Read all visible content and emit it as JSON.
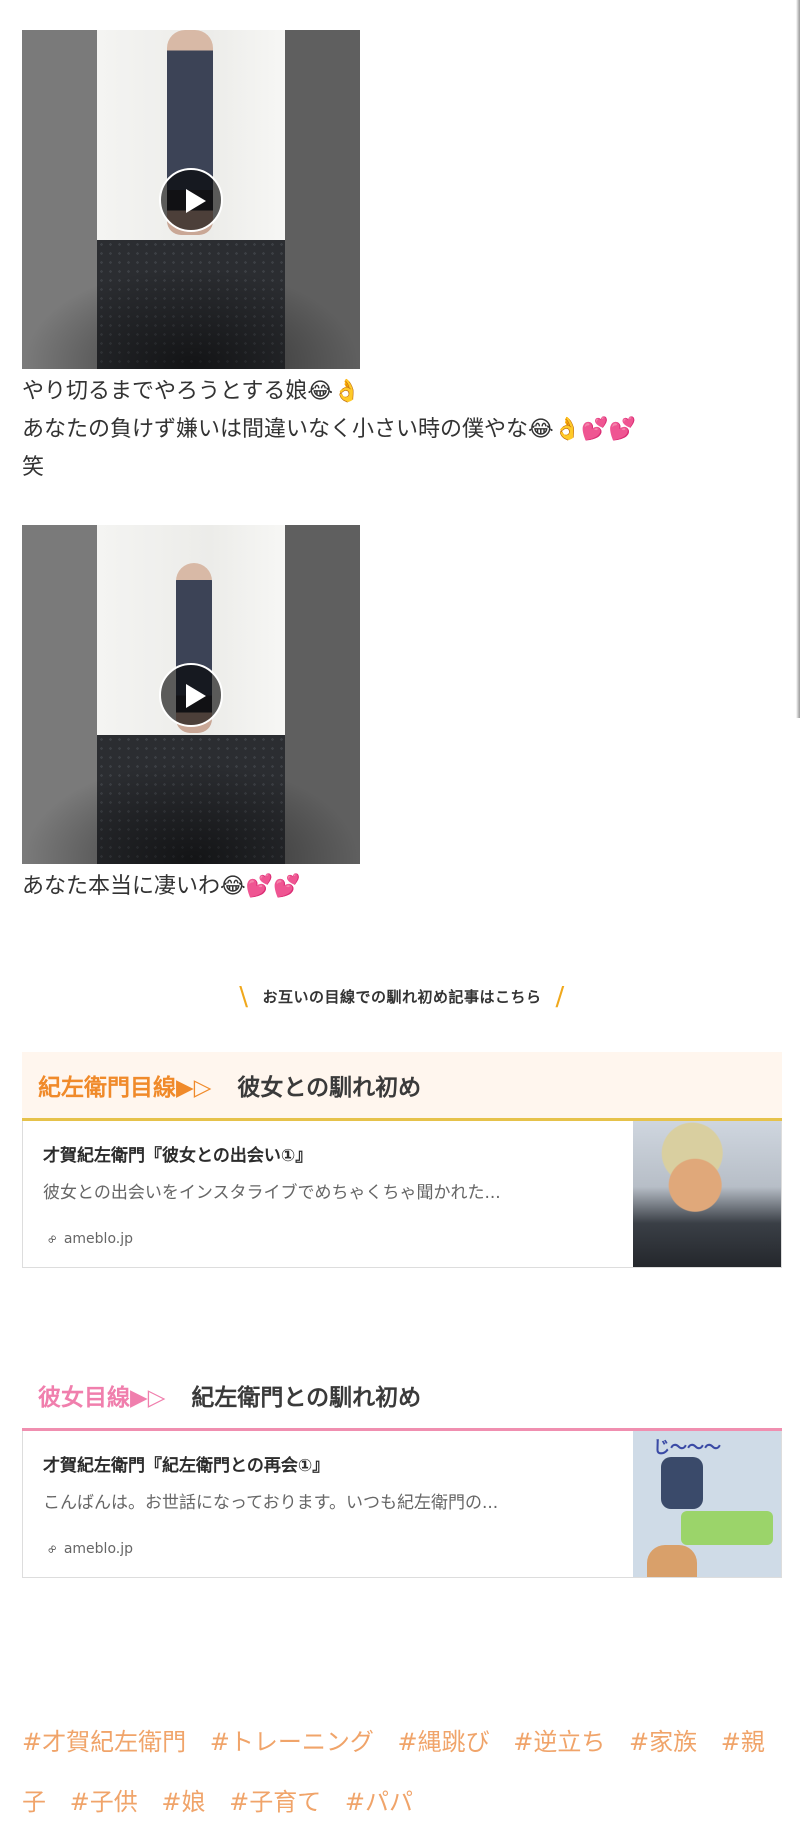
{
  "post": {
    "caption1_line1": "やり切るまでやろうとする娘😂👌",
    "caption1_line2": "あなたの負けず嫌いは間違いなく小さい時の僕やな😂👌💕💕",
    "caption1_line3": "笑",
    "caption2": "あなた本当に凄いわ😂💕💕"
  },
  "section": {
    "heading": "お互いの目線での馴れ初め記事はこちら"
  },
  "panel1": {
    "accent": "紀左衛門目線▶▷",
    "title": "彼女との馴れ初め",
    "card": {
      "title": "才賀紀左衛門『彼女との出会い①』",
      "description": "彼女との出会いをインスタライブでめちゃくちゃ聞かれた...",
      "site": "ameblo.jp"
    }
  },
  "panel2": {
    "accent": "彼女目線▶▷",
    "title": "紀左衛門との馴れ初め",
    "card": {
      "title": "才賀紀左衛門『紀左衛門との再会①』",
      "description": "こんばんは。お世話になっております。いつも紀左衛門の...",
      "site": "ameblo.jp",
      "thumb_text": "じ〜〜〜"
    }
  },
  "hashtags": [
    "#才賀紀左衛門",
    "#トレーニング",
    "#縄跳び",
    "#逆立ち",
    "#家族",
    "#親子",
    "#子供",
    "#娘",
    "#子育て",
    "#パパ"
  ],
  "colors": {
    "orange_accent": "#f08a2a",
    "pink_accent": "#f07fad",
    "gold_border": "#e6c24a",
    "hashtag": "#f0a46a"
  }
}
